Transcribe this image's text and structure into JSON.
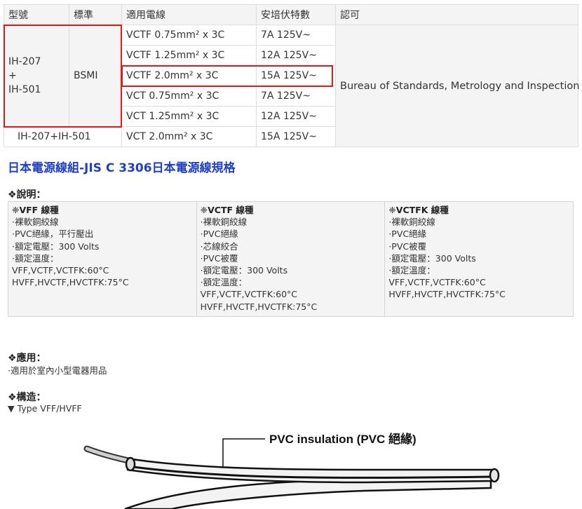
{
  "spec_table": {
    "headers": [
      "型號",
      "標準",
      "適用電線",
      "安培伏特數",
      "認可"
    ],
    "model_lines": [
      "IH-207",
      "+",
      "IH-501"
    ],
    "standard": "BSMI",
    "approval": "Bureau of Standards, Metrology and Inspection",
    "rows": [
      {
        "wire": "VCTF 0.75mm² x 3C",
        "rating": "7A 125V~"
      },
      {
        "wire": "VCTF 1.25mm² x 3C",
        "rating": "12A 125V~"
      },
      {
        "wire": "VCTF 2.0mm² x 3C",
        "rating": "15A 125V~"
      },
      {
        "wire": "VCT 0.75mm² x 3C",
        "rating": "7A 125V~"
      },
      {
        "wire": "VCT 1.25mm² x 3C",
        "rating": "12A 125V~"
      }
    ],
    "combo_row": {
      "model": "IH-207+IH-501",
      "wire": "VCT 2.0mm² x 3C",
      "rating": "15A 125V~"
    },
    "highlight_color": "#e01818"
  },
  "heading": "日本電源線組-JIS C 3306日本電源線規格",
  "heading_color": "#1f3fc4",
  "description": {
    "label": "❖說明：",
    "columns": [
      {
        "title": "❈VFF 線種",
        "lines": [
          "·裸軟銅絞線",
          "·PVC絕緣，平行壓出",
          "·額定電壓：300 Volts",
          "·額定溫度：",
          "VFF,VCTF,VCTFK:60°C",
          "HVFF,HVCTF,HVCTFK:75°C"
        ]
      },
      {
        "title": "❈VCTF 線種",
        "lines": [
          "·裸軟銅絞線",
          "·PVC絕緣",
          "·芯線絞合",
          "·PVC被覆",
          "·額定電壓：300 Volts",
          "·額定溫度：",
          "VFF,VCTF,VCTFK:60°C",
          "HVFF,HVCTF,HVCTFK:75°C"
        ]
      },
      {
        "title": "❈VCTFK 線種",
        "lines": [
          "·裸軟銅絞線",
          "·PVC絕緣",
          "·PVC被覆",
          "·額定電壓：300 Volts",
          "·額定溫度：",
          "VFF,VCTF,VCTFK:60°C",
          "HVFF,HVCTF,HVCTFK:75°C"
        ]
      }
    ]
  },
  "application": {
    "label": "❖應用：",
    "text": "·適用於室內小型電器用品"
  },
  "construction": {
    "label": "❖構造：",
    "type_line": "▼ Type VFF/HVFF"
  },
  "illustration": {
    "callout": "PVC insulation (PVC 絕緣)"
  }
}
